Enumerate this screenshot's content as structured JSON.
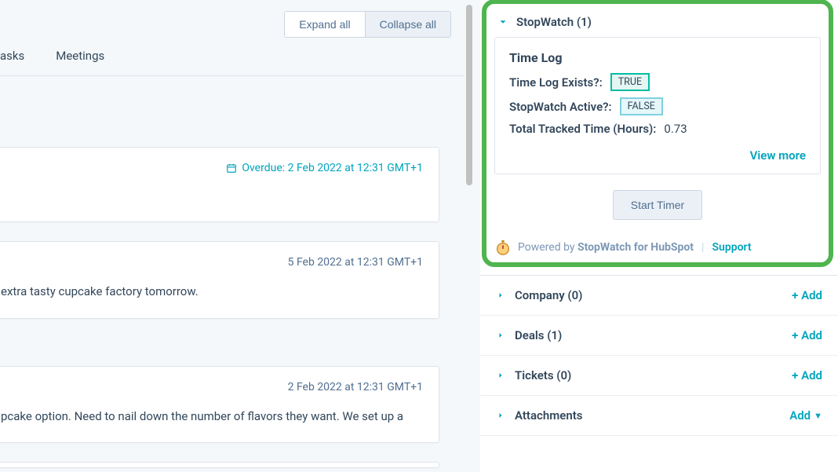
{
  "toolbar": {
    "expand_all": "Expand all",
    "collapse_all": "Collapse all"
  },
  "tabs": {
    "tasks": "asks",
    "meetings": "Meetings"
  },
  "cards": [
    {
      "overdue_prefix": "Overdue: ",
      "overdue_date": "2 Feb 2022 at 12:31 GMT+1"
    },
    {
      "date": "5 Feb 2022 at 12:31 GMT+1",
      "body": "extra tasty cupcake factory tomorrow."
    },
    {
      "date": "2 Feb 2022 at 12:31 GMT+1",
      "body": "pcake option. Need to nail down the number of flavors they want. We set up a"
    }
  ],
  "stopwatch": {
    "header": "StopWatch (1)",
    "card_title": "Time Log",
    "exists_label": "Time Log Exists?:",
    "exists_value": "TRUE",
    "active_label": "StopWatch Active?:",
    "active_value": "FALSE",
    "total_label": "Total Tracked Time (Hours):",
    "total_value": "0.73",
    "view_more": "View more",
    "start_timer": "Start Timer",
    "powered_prefix": "Powered by ",
    "powered_name": "StopWatch for HubSpot",
    "support": "Support"
  },
  "accordions": [
    {
      "title": "Company (0)",
      "action": "+ Add",
      "has_caret": false
    },
    {
      "title": "Deals (1)",
      "action": "+ Add",
      "has_caret": false
    },
    {
      "title": "Tickets (0)",
      "action": "+ Add",
      "has_caret": false
    },
    {
      "title": "Attachments",
      "action": "Add",
      "has_caret": true
    }
  ]
}
